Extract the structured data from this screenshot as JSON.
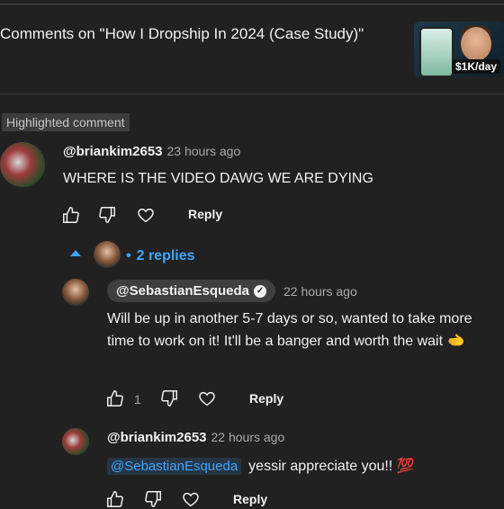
{
  "header": {
    "title": "Comments on \"How I Dropship In 2024 (Case Study)\"",
    "thumbnail_label": "$1K/day"
  },
  "highlight_label": "Highlighted comment",
  "comment": {
    "author": "@briankim2653",
    "time": "23 hours ago",
    "text": "WHERE IS THE VIDEO DAWG WE ARE DYING",
    "reply_label": "Reply"
  },
  "replies_toggle": {
    "label": "2 replies",
    "separator": "•"
  },
  "replies": [
    {
      "author": "@SebastianEsqueda",
      "time": "22 hours ago",
      "text": "Will be up in another 5-7 days or so, wanted to take more time to work on it! It'll be a banger and worth the wait 🫲",
      "likes": "1",
      "reply_label": "Reply",
      "verified": true
    },
    {
      "author": "@briankim2653",
      "time": "22 hours ago",
      "mention": "@SebastianEsqueda",
      "text": "yessir appreciate you!! 💯",
      "reply_label": "Reply"
    }
  ],
  "colors": {
    "background": "#212121",
    "link": "#3ea6ff",
    "muted": "#aaaaaa"
  },
  "icons": [
    "thumb-up-icon",
    "thumb-down-icon",
    "heart-icon",
    "caret-up-icon",
    "check-icon"
  ]
}
